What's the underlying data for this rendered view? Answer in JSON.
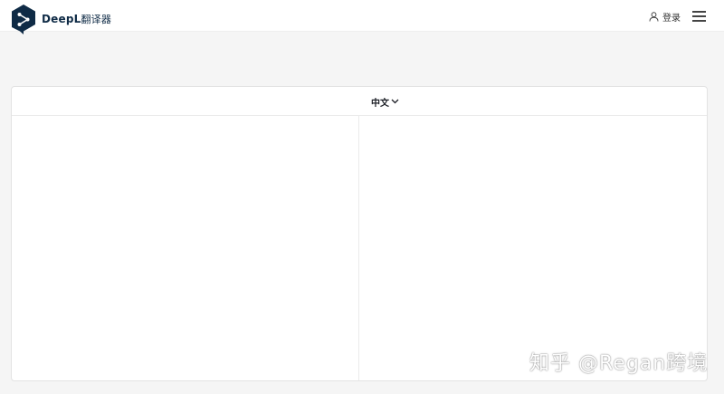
{
  "header": {
    "brand_name": "DeepL",
    "brand_suffix": "翻译器",
    "login_label": "登录",
    "icons": {
      "logo": "deepl-logo-icon",
      "user": "user-icon",
      "menu": "hamburger-menu-icon"
    }
  },
  "translator": {
    "target_language": "中文",
    "source_text": "",
    "target_text": ""
  },
  "watermark": "知乎 @Regan跨境",
  "colors": {
    "brand": "#0f2b46",
    "background": "#f5f5f5",
    "panel": "#ffffff"
  }
}
